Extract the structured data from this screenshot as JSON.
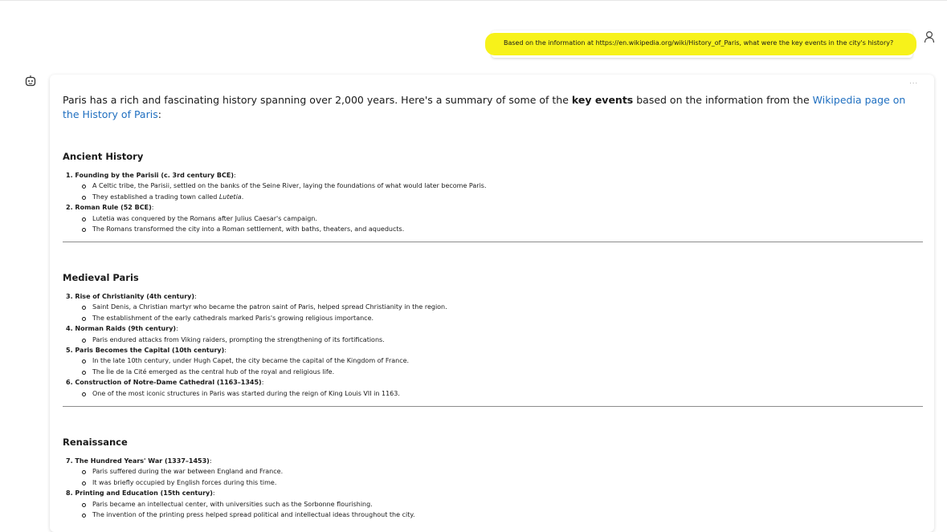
{
  "user_message": {
    "text": "Based on the information at https://en.wikipedia.org/wiki/History_of_Paris, what were the key events in the city's history?"
  },
  "icons": {
    "user": "user-icon",
    "bot": "bot-icon",
    "more": "more-options-icon"
  },
  "assistant": {
    "more_label": "...",
    "intro_part1": "Paris has a rich and fascinating history spanning over 2,000 years. Here's a summary of some of the ",
    "intro_bold": "key events",
    "intro_part2": " based on the information from the ",
    "intro_link": "Wikipedia page on the History of Paris",
    "intro_end": ":",
    "sections": [
      {
        "heading": "Ancient History",
        "items": [
          {
            "number": "1.",
            "title": "Founding by the Parisii (c. 3rd century BCE)",
            "suffix": ":",
            "bullets": [
              "A Celtic tribe, the Parisii, settled on the banks of the Seine River, laying the foundations of what would later become Paris.",
              "They established a trading town called"
            ],
            "italic_word": "Lutetia",
            "italic_end": "."
          },
          {
            "number": "2.",
            "title": "Roman Rule (52 BCE)",
            "suffix": ":",
            "bullets": [
              "Lutetia was conquered by the Romans after Julius Caesar's campaign.",
              "The Romans transformed the city into a Roman settlement, with baths, theaters, and aqueducts."
            ]
          }
        ]
      },
      {
        "heading": "Medieval Paris",
        "items": [
          {
            "number": "3.",
            "title": "Rise of Christianity (4th century)",
            "suffix": ":",
            "bullets": [
              "Saint Denis, a Christian martyr who became the patron saint of Paris, helped spread Christianity in the region.",
              "The establishment of the early cathedrals marked Paris's growing religious importance."
            ]
          },
          {
            "number": "4.",
            "title": "Norman Raids (9th century)",
            "suffix": ":",
            "bullets": [
              "Paris endured attacks from Viking raiders, prompting the strengthening of its fortifications."
            ]
          },
          {
            "number": "5.",
            "title": "Paris Becomes the Capital (10th century)",
            "suffix": ":",
            "bullets": [
              "In the late 10th century, under Hugh Capet, the city became the capital of the Kingdom of France.",
              "The Île de la Cité emerged as the central hub of the royal and religious life."
            ]
          },
          {
            "number": "6.",
            "title": "Construction of Notre-Dame Cathedral (1163–1345)",
            "suffix": ":",
            "bullets": [
              "One of the most iconic structures in Paris was started during the reign of King Louis VII in 1163."
            ]
          }
        ]
      },
      {
        "heading": "Renaissance",
        "items": [
          {
            "number": "7.",
            "title": "The Hundred Years' War (1337–1453)",
            "suffix": ":",
            "bullets": [
              "Paris suffered during the war between England and France.",
              "It was briefly occupied by English forces during this time."
            ]
          },
          {
            "number": "8.",
            "title": "Printing and Education (15th century)",
            "suffix": ":",
            "bullets": [
              "Paris became an intellectual center, with universities such as the Sorbonne flourishing.",
              "The invention of the printing press helped spread political and intellectual ideas throughout the city."
            ]
          }
        ]
      }
    ]
  }
}
